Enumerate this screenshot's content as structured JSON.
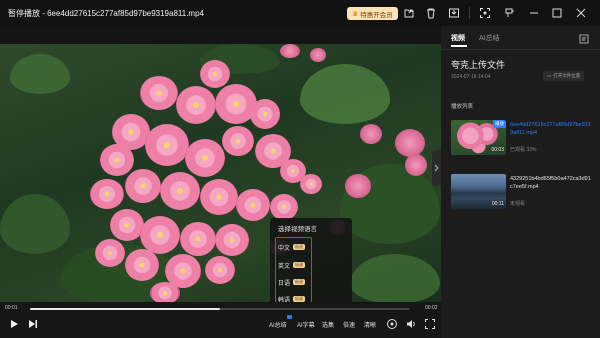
{
  "window": {
    "title": "暂停播放 - 6ee4dd27615c277af85d97be9319a811.mp4",
    "vip_label": "特惠开会员"
  },
  "toolbar_icons": [
    "open-file-icon",
    "delete-icon",
    "save-icon",
    "screenshot-icon",
    "pin-icon",
    "minimize-icon",
    "maximize-icon",
    "close-icon"
  ],
  "language_popup": {
    "title": "选择视频语言",
    "items": [
      {
        "label": "中文",
        "tag": "极速"
      },
      {
        "label": "英文",
        "tag": "极速"
      },
      {
        "label": "日语",
        "tag": "极速"
      },
      {
        "label": "韩语",
        "tag": "极速"
      }
    ]
  },
  "playback": {
    "current_time": "00:01",
    "total_time": "00:02",
    "progress": 0.5,
    "buttons": {
      "ai_summary": "AI总结",
      "ai_subtitle": "AI字幕",
      "episodes": "选集",
      "speed": "倍速",
      "quality": "清晰"
    }
  },
  "side_panel": {
    "tabs": [
      "视频",
      "AI总结"
    ],
    "active_tab": 0,
    "source_title": "夸克上传文件",
    "source_date": "2024-07-18 14:04",
    "open_location": "打开文件位置",
    "playlist_title": "播放列表",
    "playlist": [
      {
        "name": "6ee4dd27615c277af85d97be9319a811.mp4",
        "duration": "00:03",
        "badge": "播放",
        "status": "已观看 33%",
        "active": true
      },
      {
        "name": "4329251b4bd65f5b0a472ca3d91c7ee5f.mp4",
        "duration": "00:11",
        "status": "未观看",
        "active": false
      }
    ]
  },
  "colors": {
    "accent_blue": "#2f7cf6",
    "highlight_red": "#e0302a",
    "vip_bg": "#fbe3b8"
  }
}
